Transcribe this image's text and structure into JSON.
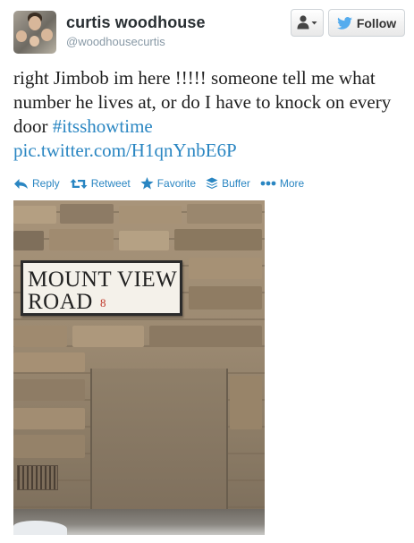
{
  "header": {
    "display_name": "curtis woodhouse",
    "handle": "@woodhousecurtis",
    "follow_label": "Follow",
    "avatar_icon": "profile-photo",
    "user_actions_icon": "user-dropdown-icon"
  },
  "tweet": {
    "text_before": "right Jimbob im here !!!!! someone tell me what number he lives at, or do I have to knock on every door ",
    "hashtag": "#itsshowtime",
    "link": "pic.twitter.com/H1qnYnbE6P"
  },
  "actions": {
    "reply": "Reply",
    "retweet": "Retweet",
    "favorite": "Favorite",
    "buffer": "Buffer",
    "more": "More"
  },
  "photo": {
    "sign_line1": "MOUNT VIEW",
    "sign_line2": "ROAD",
    "sign_number": "8"
  },
  "colors": {
    "link": "#2a86c2",
    "text": "#1f1f1f",
    "muted": "#8899a6",
    "twitter_bird": "#55acee"
  }
}
